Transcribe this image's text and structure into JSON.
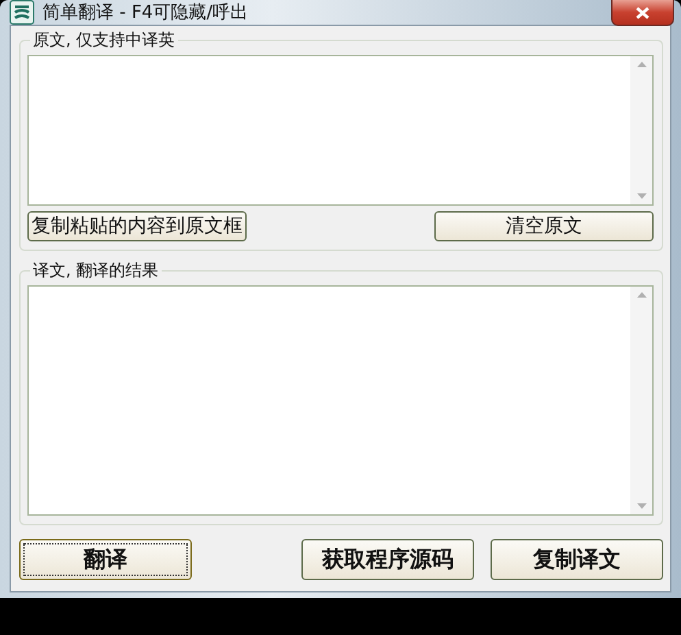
{
  "window": {
    "title": "简单翻译  -  F4可隐藏/呼出"
  },
  "source_group": {
    "label": "原文, 仅支持中译英",
    "buttons": [
      {
        "label": "复制粘贴的内容到原文框",
        "focused": false
      },
      {
        "label": "清空原文",
        "focused": false
      }
    ]
  },
  "result_group": {
    "label": "译文, 翻译的结果"
  },
  "buttons": [
    {
      "label": "翻译",
      "focused": true
    },
    {
      "label": "获取程序源码",
      "focused": false
    },
    {
      "label": "复制译文",
      "focused": false
    }
  ]
}
